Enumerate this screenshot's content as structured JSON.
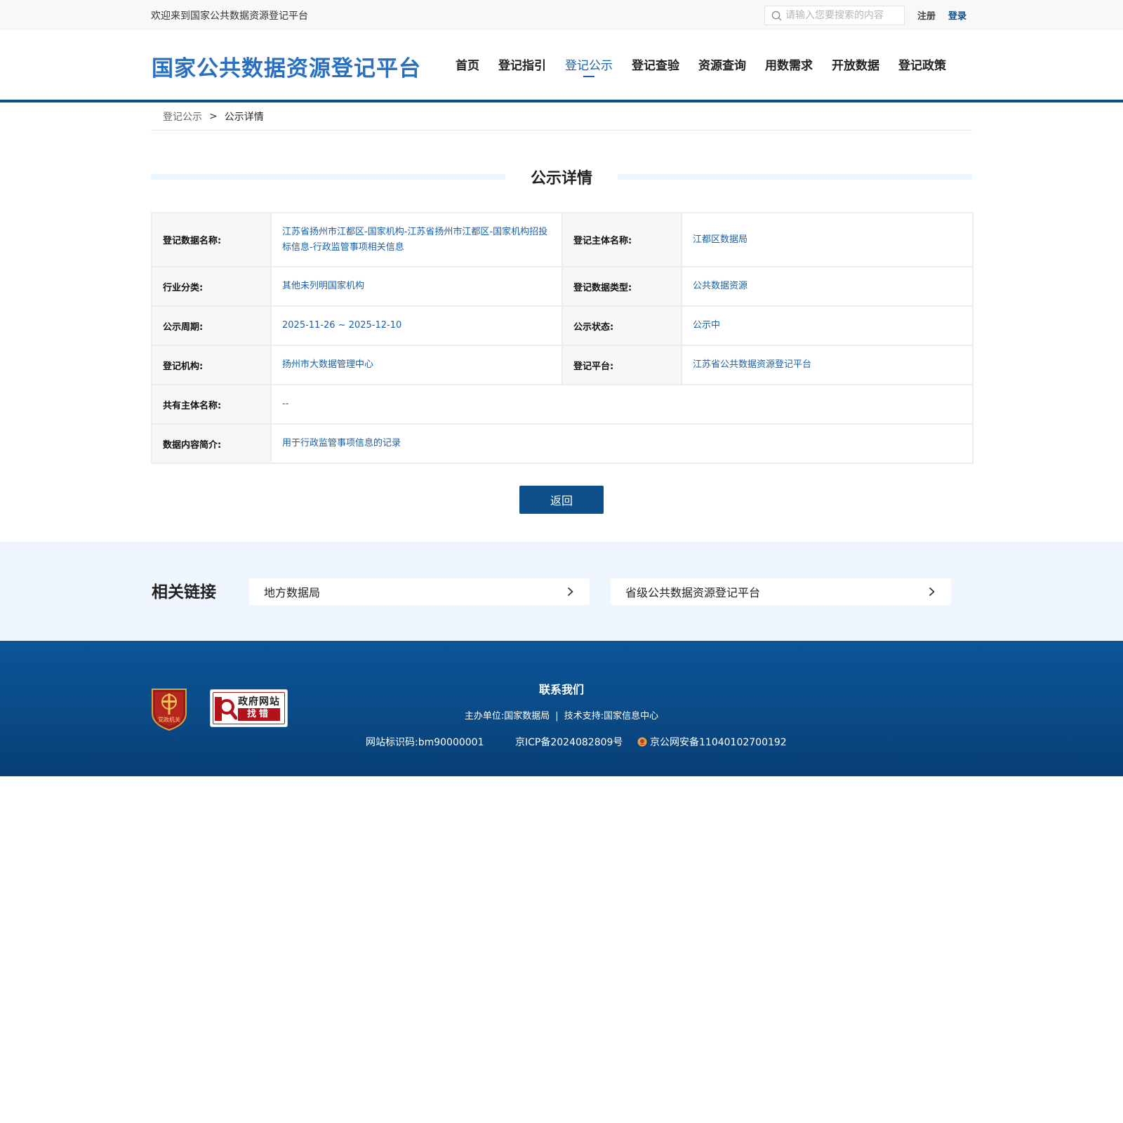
{
  "topbar": {
    "welcome": "欢迎来到国家公共数据资源登记平台",
    "search_placeholder": "请输入您要搜索的内容",
    "register": "注册",
    "login": "登录"
  },
  "header": {
    "logo": "国家公共数据资源登记平台",
    "nav": [
      "首页",
      "登记指引",
      "登记公示",
      "登记查验",
      "资源查询",
      "用数需求",
      "开放数据",
      "登记政策"
    ],
    "active_nav": "登记公示"
  },
  "breadcrumb": {
    "parent": "登记公示",
    "separator": ">",
    "current": "公示详情"
  },
  "page_title": "公示详情",
  "details": {
    "data_name_label": "登记数据名称:",
    "data_name": "江苏省扬州市江都区-国家机构-江苏省扬州市江都区-国家机构招投标信息-行政监管事项相关信息",
    "subject_label": "登记主体名称:",
    "subject": "江都区数据局",
    "industry_label": "行业分类:",
    "industry": "其他未列明国家机构",
    "data_type_label": "登记数据类型:",
    "data_type": "公共数据资源",
    "period_label": "公示周期:",
    "period": "2025-11-26 ~ 2025-12-10",
    "status_label": "公示状态:",
    "status": "公示中",
    "org_label": "登记机构:",
    "org": "扬州市大数据管理中心",
    "platform_label": "登记平台:",
    "platform": "江苏省公共数据资源登记平台",
    "co_owner_label": "共有主体名称:",
    "co_owner": "--",
    "summary_label": "数据内容简介:",
    "summary": "用于行政监管事项信息的记录"
  },
  "back_button": "返回",
  "related": {
    "title": "相关链接",
    "links": [
      "地方数据局",
      "省级公共数据资源登记平台"
    ]
  },
  "footer": {
    "party_badge": "党政机关",
    "gov_badge_line1": "政府网站",
    "gov_badge_line2": "找错",
    "contact_title": "联系我们",
    "sponsor": "主办单位:国家数据局",
    "divider": "|",
    "tech_support": "技术支持:国家信息中心",
    "site_id": "网站标识码:bm90000001",
    "icp": "京ICP备2024082809号",
    "police": "京公网安备11040102700192"
  },
  "colors": {
    "brand_blue": "#0d4f8b",
    "logo_blue": "#2a6fc0",
    "value_blue": "#1c5fa8",
    "related_bg": "#eff6fe",
    "badge_red": "#b3121b"
  }
}
